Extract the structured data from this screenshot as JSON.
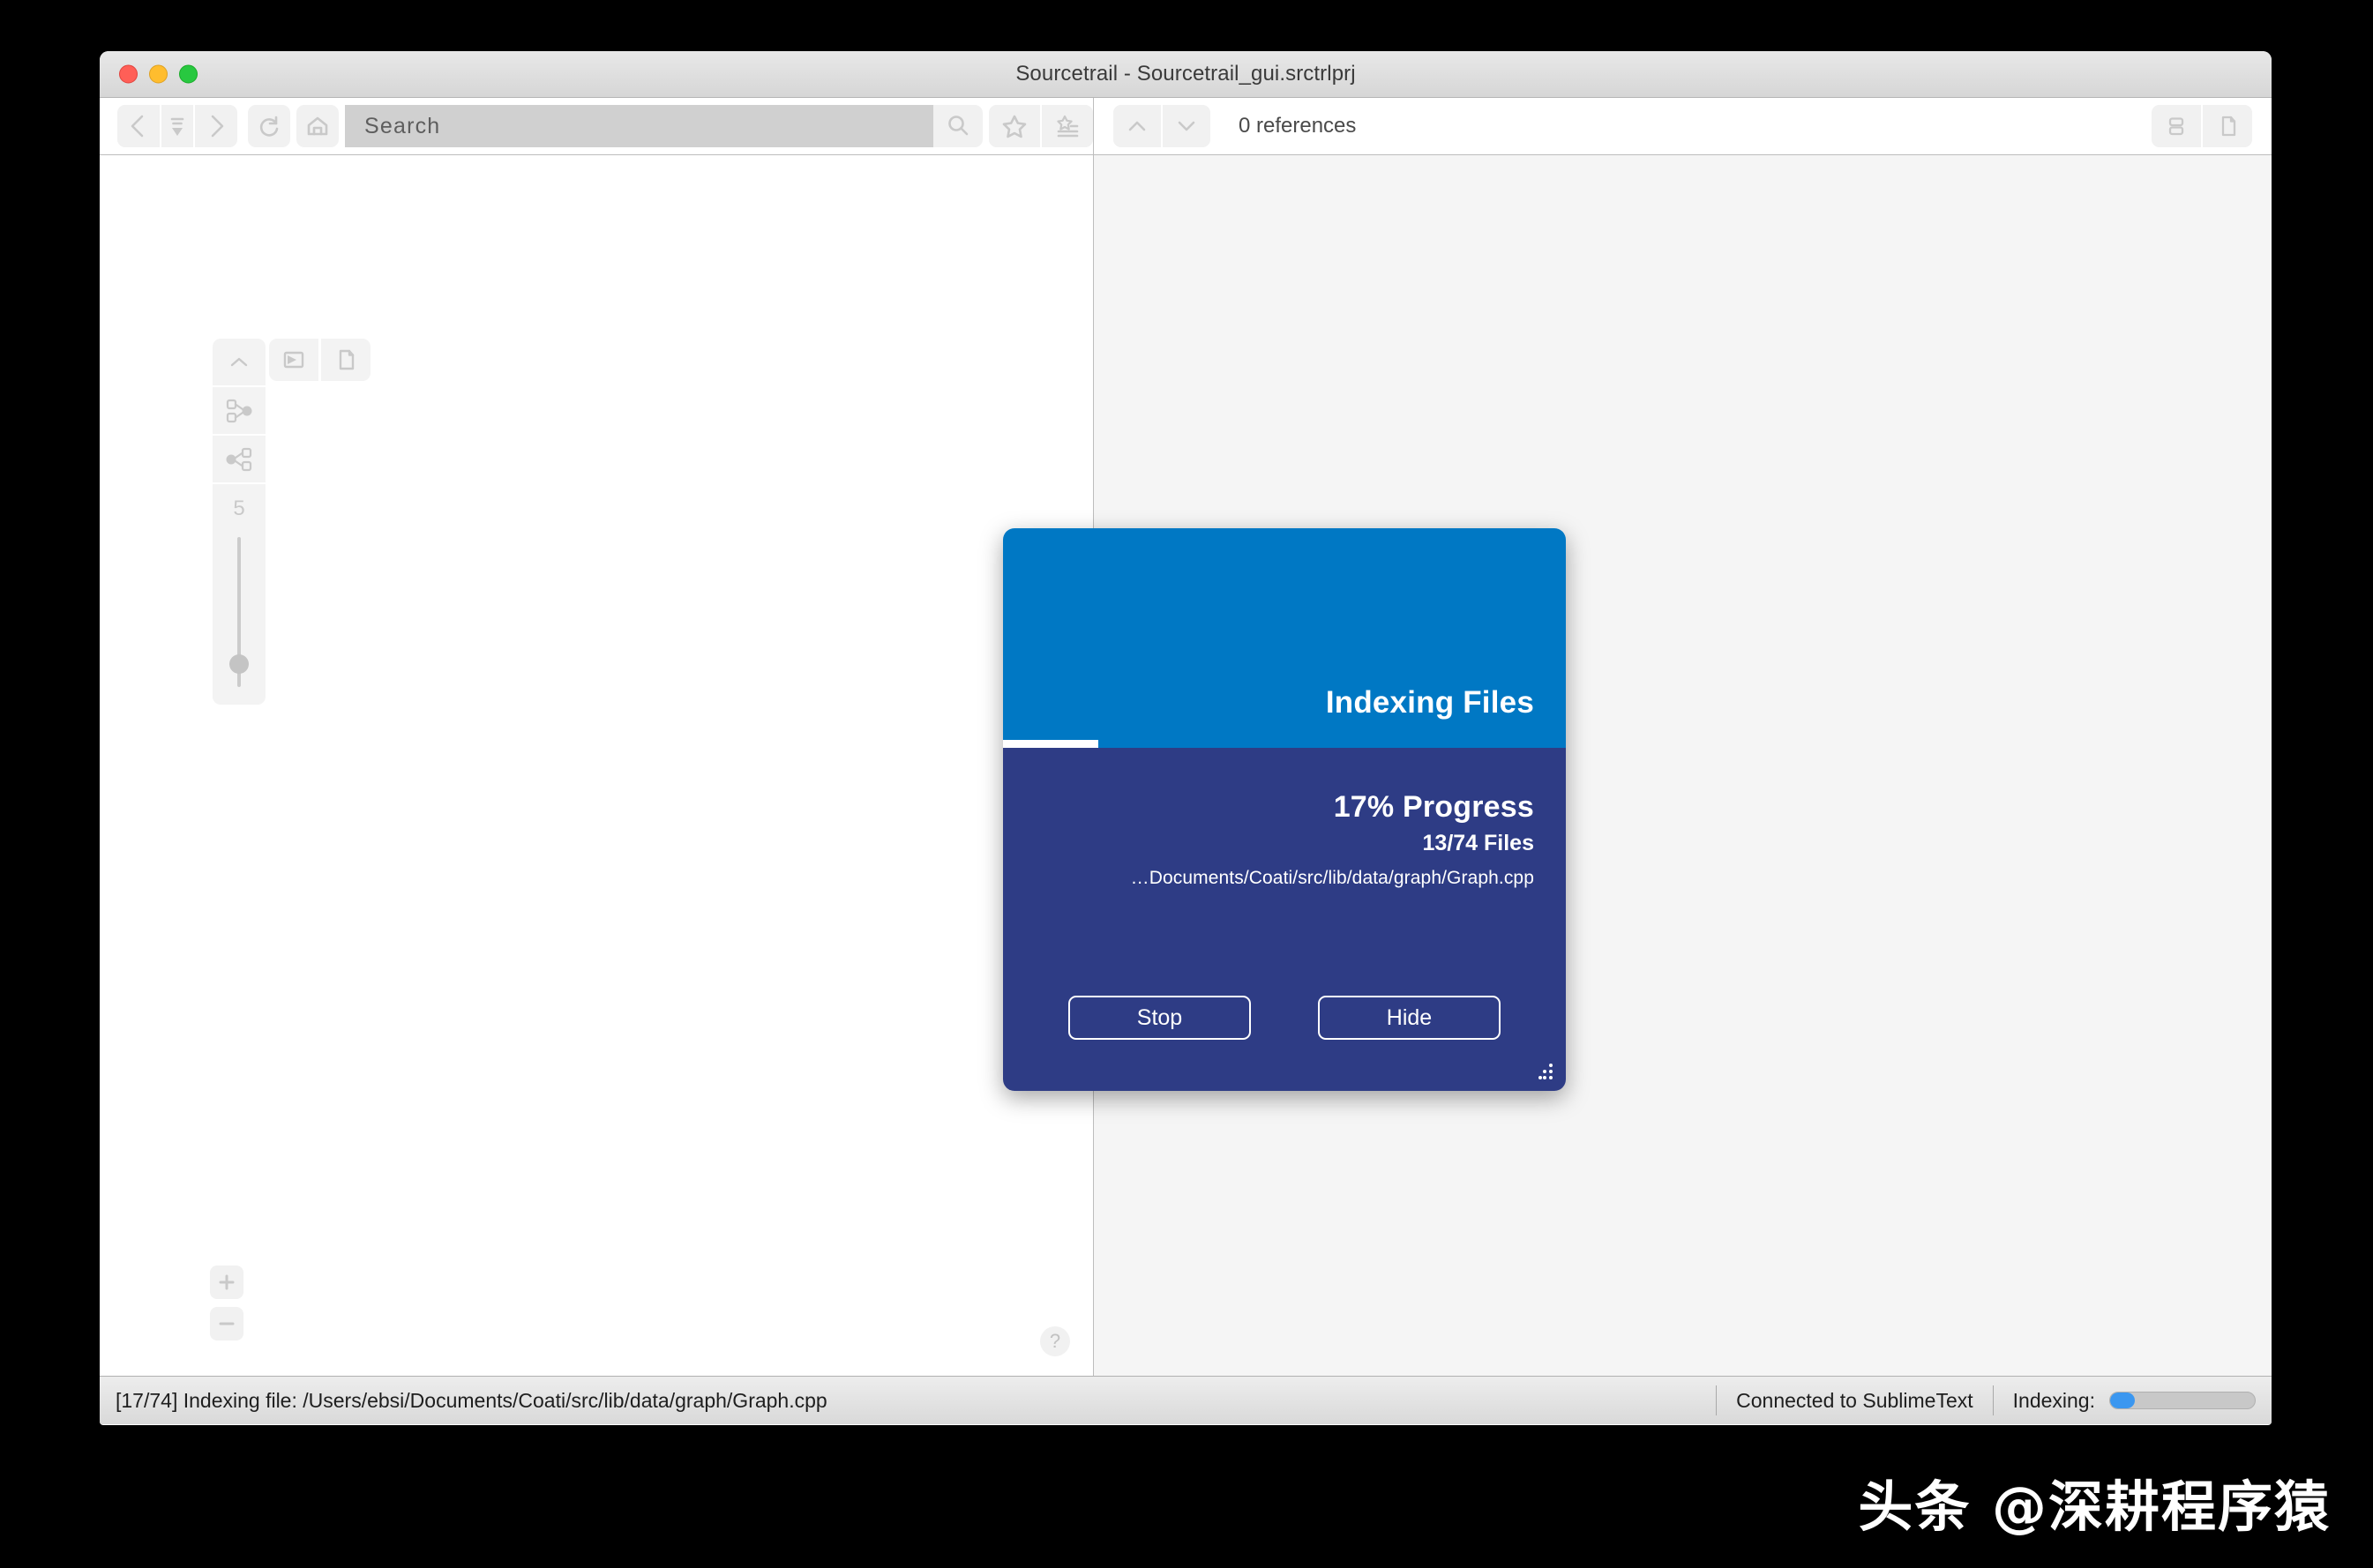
{
  "window": {
    "title": "Sourcetrail - Sourcetrail_gui.srctrlprj",
    "traffic_lights": [
      "close",
      "minimize",
      "zoom"
    ]
  },
  "toolbar": {
    "back_icon": "back-arrow-icon",
    "history_icon": "history-list-icon",
    "forward_icon": "forward-arrow-icon",
    "refresh_icon": "refresh-icon",
    "home_icon": "home-icon",
    "search_placeholder": "Search",
    "search_value": "",
    "search_icon": "magnifier-icon",
    "bookmark_icon": "star-icon",
    "bookmark_list_icon": "bookmark-list-icon"
  },
  "code_toolbar": {
    "prev_icon": "chevron-up-icon",
    "next_icon": "chevron-down-icon",
    "reference_count": "0 references",
    "list_view_icon": "split-list-icon",
    "single_view_icon": "single-file-icon"
  },
  "graph_pane": {
    "collapse_icon": "chevron-up-icon",
    "incoming_graph_icon": "graph-incoming-icon",
    "outgoing_graph_icon": "graph-outgoing-icon",
    "depth_value": "5",
    "label_icon": "label-icon",
    "file_icon": "file-icon",
    "zoom_in_label": "+",
    "zoom_out_label": "−",
    "help_label": "?"
  },
  "dialog": {
    "title": "Indexing Files",
    "progress_percent_label": "17% Progress",
    "progress_percent": 17,
    "files_label": "13/74 Files",
    "files_done": 13,
    "files_total": 74,
    "current_file": "…Documents/Coati/src/lib/data/graph/Graph.cpp",
    "stop_label": "Stop",
    "hide_label": "Hide",
    "header_color": "#0078c4",
    "body_color": "#2e3c85"
  },
  "statusbar": {
    "message": "[17/74] Indexing file: /Users/ebsi/Documents/Coati/src/lib/data/graph/Graph.cpp",
    "connection": "Connected to SublimeText",
    "indexing_label": "Indexing:",
    "indexing_percent": 17,
    "indexing_color": "#3b97f0"
  },
  "watermark": {
    "text": "头条 @深耕程序猿"
  }
}
